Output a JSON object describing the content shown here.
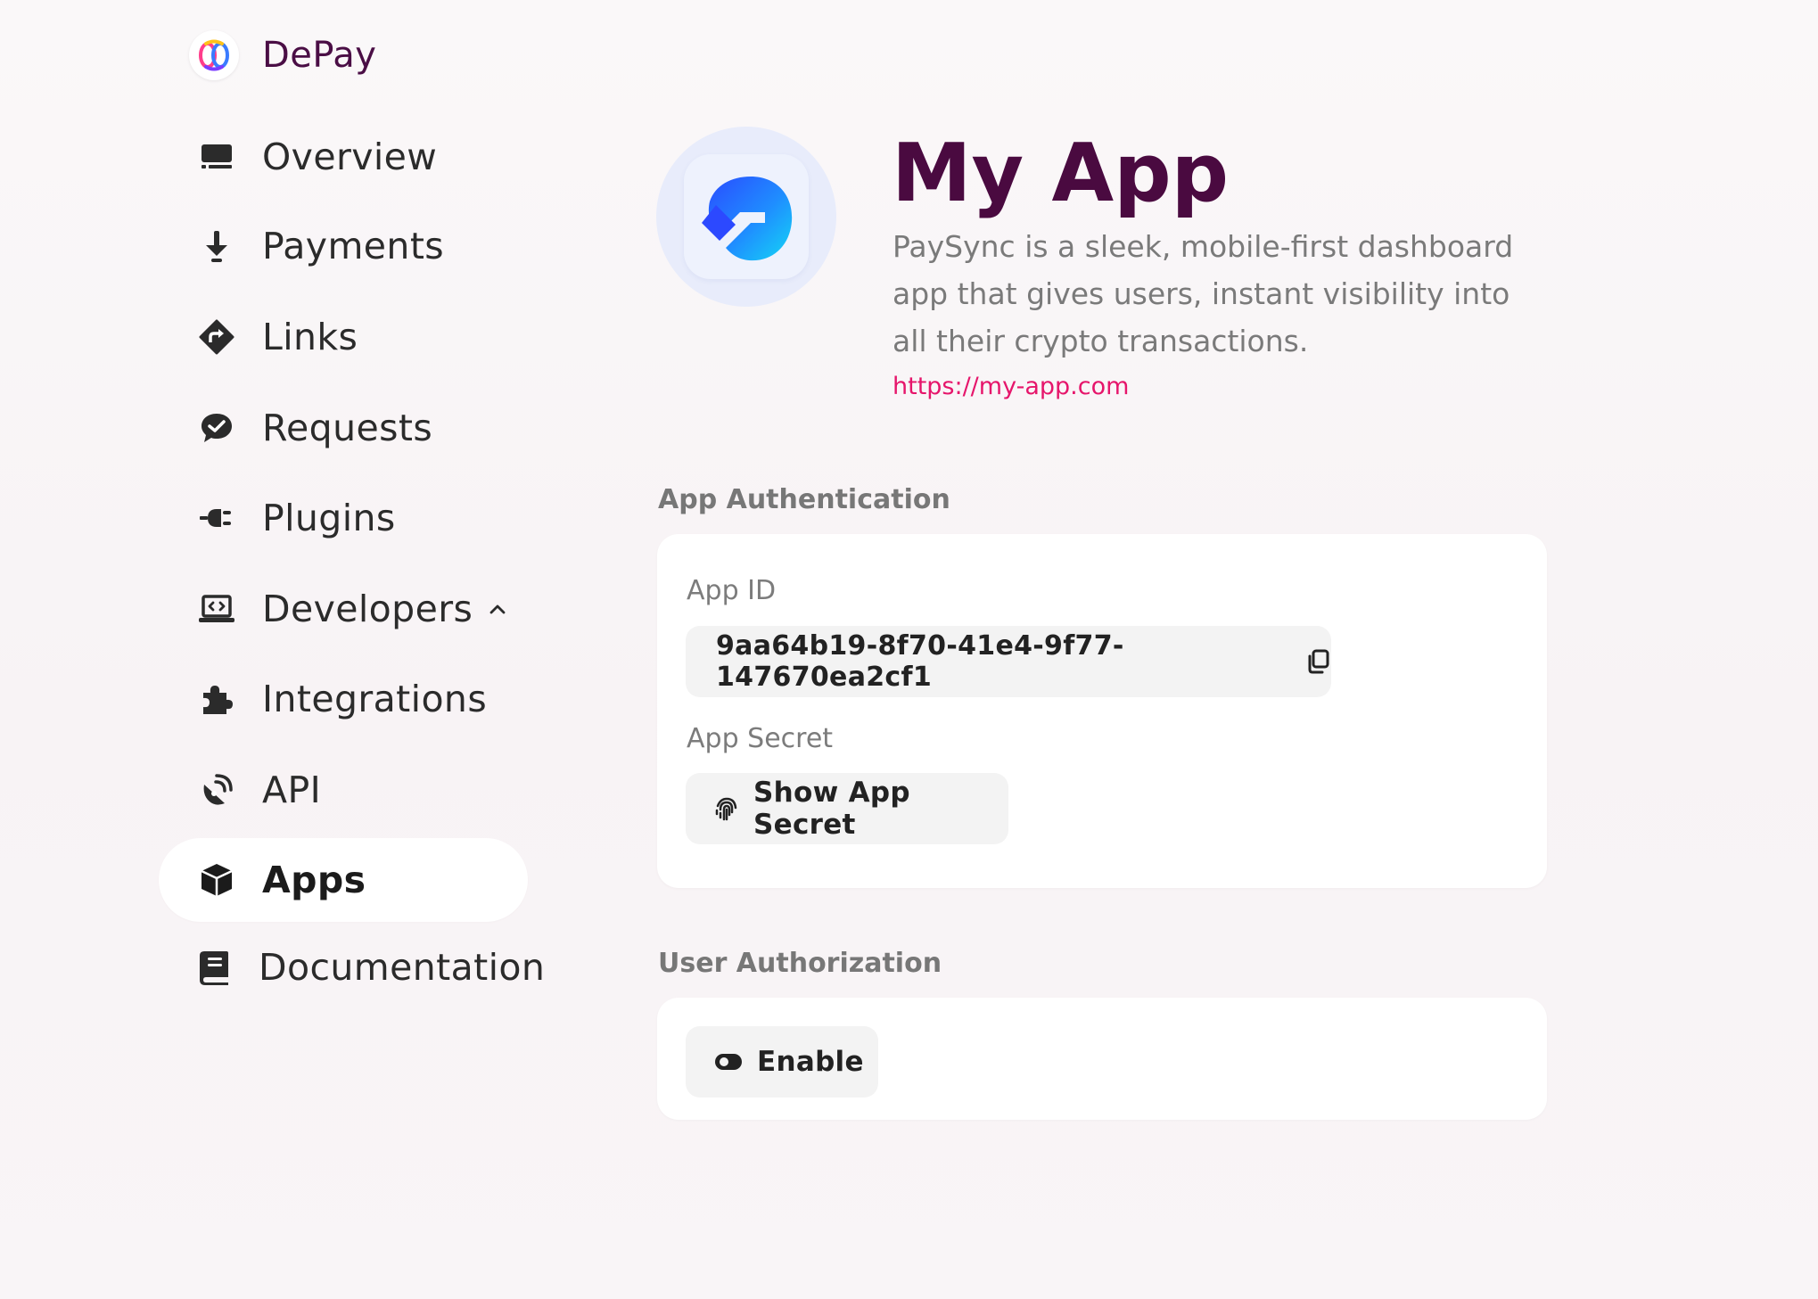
{
  "brand": {
    "name": "DePay"
  },
  "sidebar": {
    "items": [
      {
        "label": "Overview",
        "icon": "monitor-icon"
      },
      {
        "label": "Payments",
        "icon": "arrow-down-icon"
      },
      {
        "label": "Links",
        "icon": "diamond-turn-icon"
      },
      {
        "label": "Requests",
        "icon": "message-check-icon"
      },
      {
        "label": "Plugins",
        "icon": "plug-icon"
      },
      {
        "label": "Developers",
        "icon": "laptop-code-icon",
        "expanded": true
      },
      {
        "label": "Integrations",
        "icon": "puzzle-icon"
      },
      {
        "label": "API",
        "icon": "satellite-dish-icon"
      },
      {
        "label": "Apps",
        "icon": "cube-icon",
        "active": true
      },
      {
        "label": "Documentation",
        "icon": "book-icon"
      }
    ]
  },
  "app": {
    "title": "My App",
    "description": "PaySync is a sleek, mobile-first dashboard app that gives users, instant visibility into all their crypto transactions.",
    "url": "https://my-app.com"
  },
  "authentication": {
    "heading": "App Authentication",
    "app_id_label": "App ID",
    "app_id": "9aa64b19-8f70-41e4-9f77-147670ea2cf1",
    "app_secret_label": "App Secret",
    "show_secret_label": "Show App Secret"
  },
  "authorization": {
    "heading": "User Authorization",
    "enable_label": "Enable"
  },
  "colors": {
    "brand_text": "#4a0e45",
    "title": "#4a0a40",
    "link": "#e6156b",
    "app_icon_blue": "#1e6bff"
  }
}
